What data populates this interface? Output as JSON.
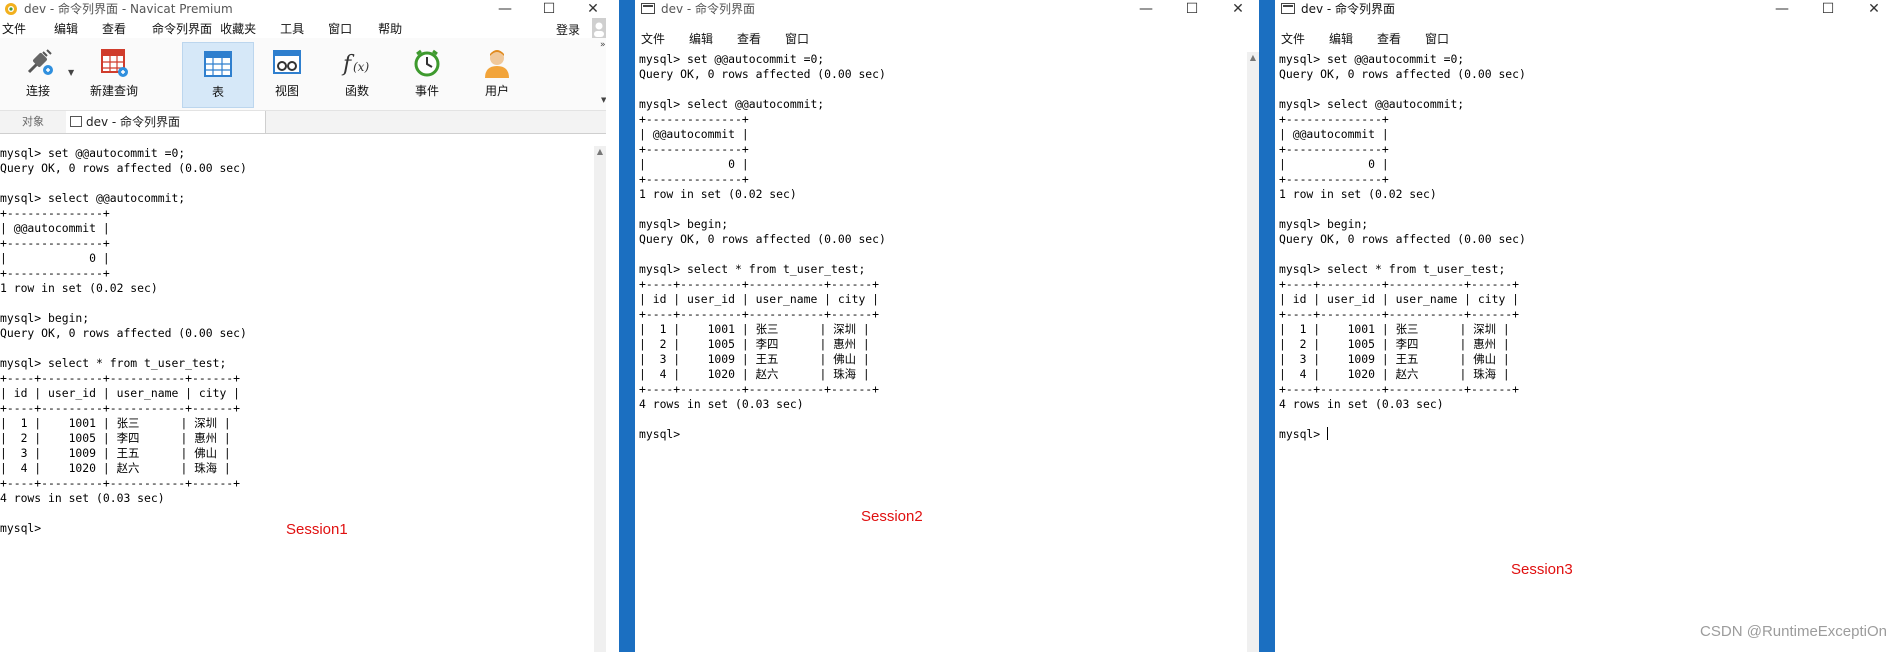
{
  "window1": {
    "title": "dev - 命令列界面 - Navicat Premium",
    "menu": [
      "文件",
      "编辑",
      "查看",
      "命令列界面",
      "收藏夹",
      "工具",
      "窗口",
      "帮助"
    ],
    "login_label": "登录",
    "toolbar": {
      "connect": "连接",
      "new_query": "新建查询",
      "table": "表",
      "view": "视图",
      "function": "函数",
      "event": "事件",
      "user": "用户"
    },
    "tabs": {
      "objects": "对象",
      "console": "dev - 命令列界面"
    },
    "console_text": "mysql> set @@autocommit =0;\nQuery OK, 0 rows affected (0.00 sec)\n\nmysql> select @@autocommit;\n+--------------+\n| @@autocommit |\n+--------------+\n|            0 |\n+--------------+\n1 row in set (0.02 sec)\n\nmysql> begin;\nQuery OK, 0 rows affected (0.00 sec)\n\nmysql> select * from t_user_test;\n+----+---------+-----------+------+\n| id | user_id | user_name | city |\n+----+---------+-----------+------+\n|  1 |    1001 | 张三      | 深圳 |\n|  2 |    1005 | 李四      | 惠州 |\n|  3 |    1009 | 王五      | 佛山 |\n|  4 |    1020 | 赵六      | 珠海 |\n+----+---------+-----------+------+\n4 rows in set (0.03 sec)\n\nmysql> ",
    "session_label": "Session1"
  },
  "window2": {
    "title": "dev - 命令列界面",
    "menu": [
      "文件",
      "编辑",
      "查看",
      "窗口"
    ],
    "console_text": "mysql> set @@autocommit =0;\nQuery OK, 0 rows affected (0.00 sec)\n\nmysql> select @@autocommit;\n+--------------+\n| @@autocommit |\n+--------------+\n|            0 |\n+--------------+\n1 row in set (0.02 sec)\n\nmysql> begin;\nQuery OK, 0 rows affected (0.00 sec)\n\nmysql> select * from t_user_test;\n+----+---------+-----------+------+\n| id | user_id | user_name | city |\n+----+---------+-----------+------+\n|  1 |    1001 | 张三      | 深圳 |\n|  2 |    1005 | 李四      | 惠州 |\n|  3 |    1009 | 王五      | 佛山 |\n|  4 |    1020 | 赵六      | 珠海 |\n+----+---------+-----------+------+\n4 rows in set (0.03 sec)\n\nmysql> ",
    "session_label": "Session2"
  },
  "window3": {
    "title": "dev - 命令列界面",
    "menu": [
      "文件",
      "编辑",
      "查看",
      "窗口"
    ],
    "console_text": "mysql> set @@autocommit =0;\nQuery OK, 0 rows affected (0.00 sec)\n\nmysql> select @@autocommit;\n+--------------+\n| @@autocommit |\n+--------------+\n|            0 |\n+--------------+\n1 row in set (0.02 sec)\n\nmysql> begin;\nQuery OK, 0 rows affected (0.00 sec)\n\nmysql> select * from t_user_test;\n+----+---------+-----------+------+\n| id | user_id | user_name | city |\n+----+---------+-----------+------+\n|  1 |    1001 | 张三      | 深圳 |\n|  2 |    1005 | 李四      | 惠州 |\n|  3 |    1009 | 王五      | 佛山 |\n|  4 |    1020 | 赵六      | 珠海 |\n+----+---------+-----------+------+\n4 rows in set (0.03 sec)\n\nmysql> ",
    "session_label": "Session3"
  },
  "watermark": "CSDN @RuntimeExceptiOn",
  "colors": {
    "accent_blue": "#1b6fc1",
    "session_red": "#e01010",
    "toolbar_active": "#d6e8f8"
  },
  "icons": [
    "navicat-logo-icon",
    "minimize-icon",
    "maximize-icon",
    "close-icon",
    "connect-plug-icon",
    "new-query-icon",
    "table-icon",
    "view-icon",
    "function-icon",
    "event-clock-icon",
    "user-icon",
    "cmd-window-icon"
  ]
}
